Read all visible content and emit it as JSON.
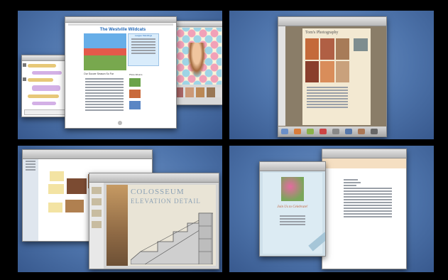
{
  "spaces": [
    {
      "name": "space-1",
      "apps": [
        "iChat",
        "Safari",
        "iPhoto"
      ]
    },
    {
      "name": "space-2",
      "apps": [
        "Pages"
      ]
    },
    {
      "name": "space-3",
      "apps": [
        "Finder",
        "Keynote"
      ]
    },
    {
      "name": "space-4",
      "apps": [
        "Pages",
        "Mail"
      ]
    }
  ],
  "school_site": {
    "title": "The Westville Wildcats",
    "story_heading": "Our Soccer Season So Far",
    "calendar_heading": "League Standings",
    "photos_heading": "Photo Albums"
  },
  "photo_site": {
    "title": "Tom's Photography"
  },
  "keynote_slide": {
    "title_line1": "Colosseum",
    "title_line2": "Elevation Detail"
  },
  "invitation": {
    "headline": "Join Us to Celebrate!"
  },
  "colors": {
    "desktop": "#4e74ab",
    "border": "#000000",
    "slide_bg": "#e9e4d6",
    "slide_title": "#8da2b5"
  }
}
